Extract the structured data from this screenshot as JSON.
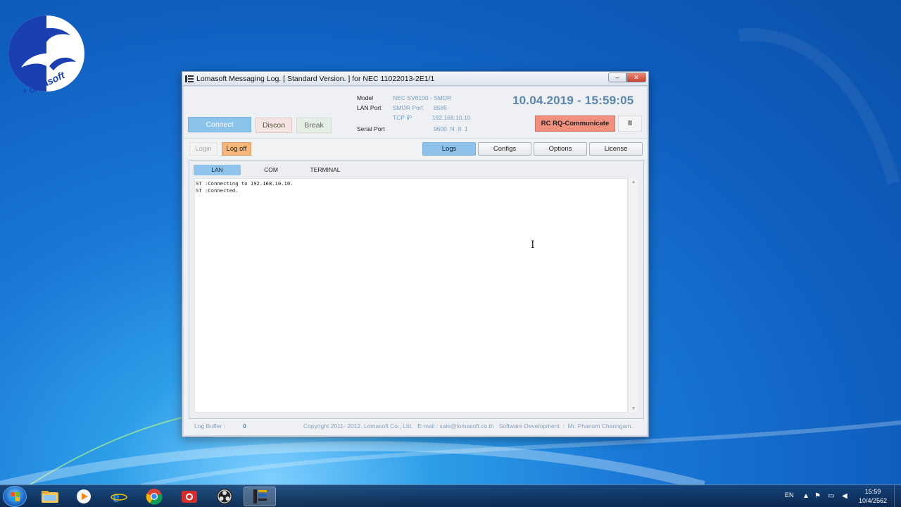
{
  "window": {
    "title": "Lomasoft Messaging Log. [ Standard Version. ] for NEC 11022013-2E1/1",
    "minimize": "‒",
    "close": "✕"
  },
  "desktop": {
    "logo_text": "Lomasoft"
  },
  "header": {
    "connect_label": "Connect",
    "discon_label": "Discon",
    "break_label": "Break",
    "model_label": "Model",
    "model_value": "NEC SV8100 - SMDR",
    "lan_port_label": "LAN Port",
    "smdr_port_label": "SMDR Port",
    "smdr_port_value": "8585",
    "tcp_ip_label": "TCP IP",
    "tcp_ip_value": "192.168.10.10",
    "serial_port_label": "Serial Port",
    "serial_port_value": "9600  N  8  1",
    "datetime": "10.04.2019 - 15:59:05",
    "rc_label": "RC RQ-Communicate",
    "pause_label": "II"
  },
  "toolbar": {
    "login_label": "Login",
    "logoff_label": "Log off",
    "tabs": [
      "Logs",
      "Configs",
      "Options",
      "License"
    ],
    "active_tab": "Logs"
  },
  "log_panel": {
    "subtabs": [
      "LAN",
      "COM",
      "TERMINAL"
    ],
    "active_subtab": "LAN",
    "lines": [
      "ST :Connecting to 192.168.10.10.",
      "ST :Connected."
    ]
  },
  "footer": {
    "log_buffer_label": "Log Buffer :",
    "log_buffer_value": "0",
    "copyright": "Copyright 2011- 2012. Lomasoft Co., Ltd.   E-mail : sale@lomasoft.co.th   Software Development  :  Mr. Phanom Channgam."
  },
  "taskbar": {
    "icons": [
      "windows-explorer-icon",
      "media-player-icon",
      "internet-explorer-icon",
      "chrome-icon",
      "camera-app-icon",
      "obs-icon",
      "lomasoft-log-icon"
    ],
    "language": "EN",
    "time": "15:59",
    "date": "10/4/2562"
  },
  "colors": {
    "accent_blue": "#8cc3ea",
    "logoff_orange": "#f5b77a",
    "rc_red": "#f0907f",
    "datetime_blue": "#5c86b0"
  }
}
